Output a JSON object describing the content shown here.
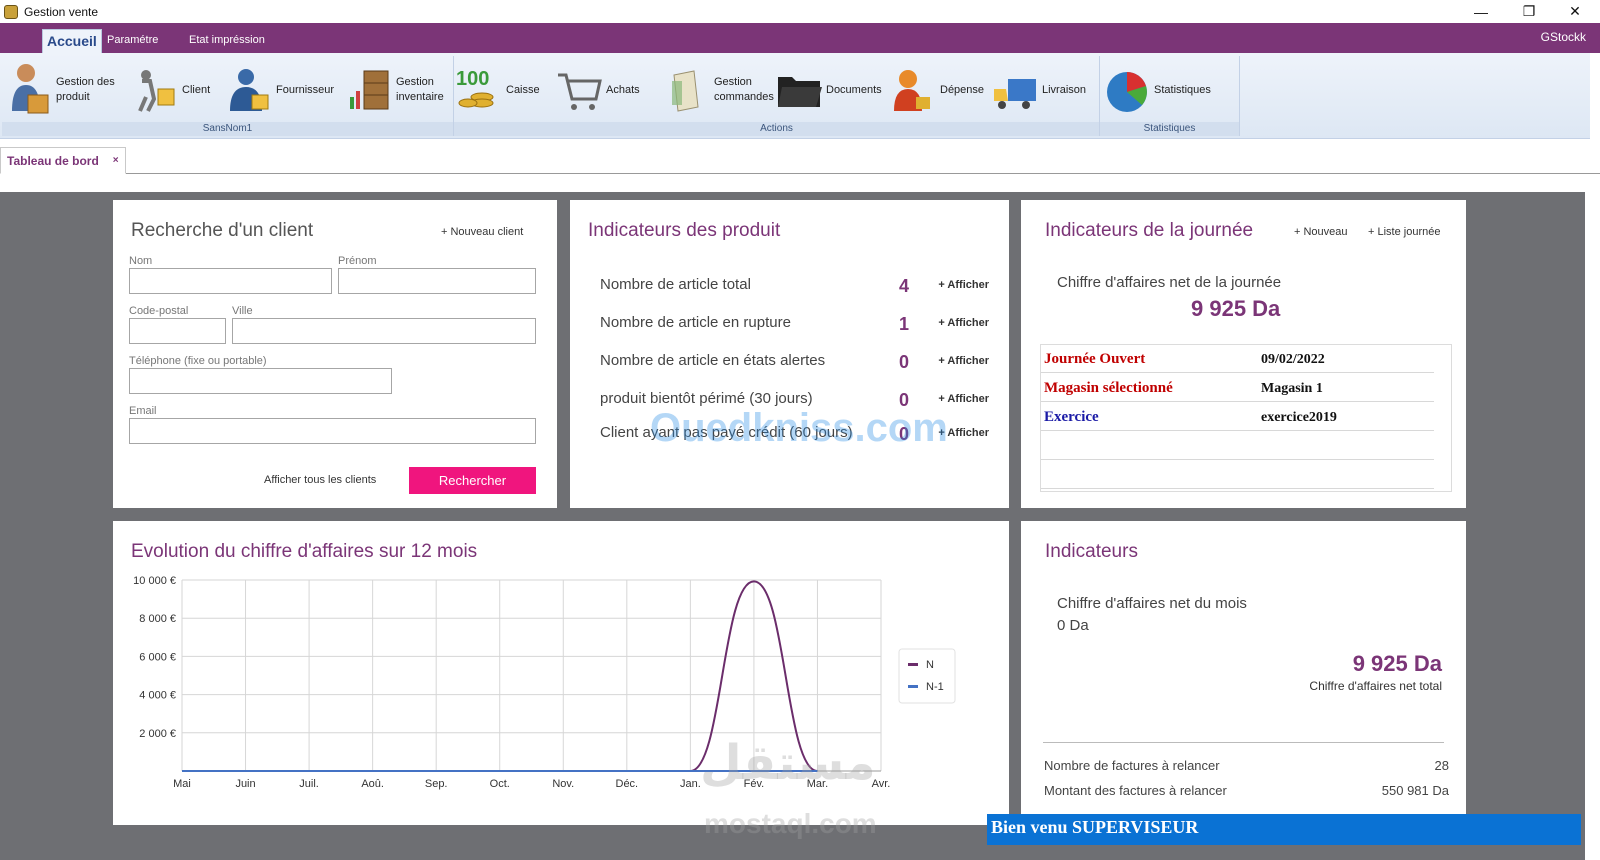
{
  "window": {
    "title": "Gestion vente",
    "minimize": "—",
    "restore": "❐",
    "close": "✕"
  },
  "menu": {
    "tabs": [
      "Accueil",
      "Paramétre",
      "Etat impréssion"
    ],
    "brand": "GStockk"
  },
  "ribbon": {
    "groups": [
      {
        "label": "SansNom1",
        "buttons": [
          {
            "label": "Gestion des produit",
            "icon": "person-box-icon"
          },
          {
            "label": "Client",
            "icon": "delivery-man-icon"
          },
          {
            "label": "Fournisseur",
            "icon": "supplier-icon"
          },
          {
            "label": "Gestion inventaire",
            "icon": "inventory-icon"
          }
        ]
      },
      {
        "label": "Actions",
        "buttons": [
          {
            "label": "Caisse",
            "icon": "coins-icon"
          },
          {
            "label": "Achats",
            "icon": "cart-icon"
          },
          {
            "label": "Gestion commandes",
            "icon": "document-ticket-icon"
          },
          {
            "label": "Documents",
            "icon": "folder-icon"
          },
          {
            "label": "Dépense",
            "icon": "person-money-icon"
          },
          {
            "label": "Livraison",
            "icon": "truck-icon"
          }
        ]
      },
      {
        "label": "Statistiques",
        "buttons": [
          {
            "label": "Statistiques",
            "icon": "pie-chart-icon"
          }
        ]
      }
    ]
  },
  "doc_tab": {
    "label": "Tableau de bord",
    "close": "×"
  },
  "client_search": {
    "title": "Recherche d'un client",
    "new_link": "+ Nouveau client",
    "labels": {
      "nom": "Nom",
      "prenom": "Prénom",
      "cp": "Code-postal",
      "ville": "Ville",
      "tel": "Téléphone (fixe ou portable)",
      "email": "Email"
    },
    "show_all": "Afficher tous les clients",
    "search_button": "Rechercher"
  },
  "product_indicators": {
    "title": "Indicateurs des produit",
    "action_label": "+ Afficher",
    "rows": [
      {
        "label": "Nombre de article total",
        "value": "4"
      },
      {
        "label": "Nombre de article en rupture",
        "value": "1"
      },
      {
        "label": "Nombre de article en états alertes",
        "value": "0"
      },
      {
        "label": "produit bientôt périmé (30 jours)",
        "value": "0"
      },
      {
        "label": "Client ayant pas payé crédit (60 jours)",
        "value": "0"
      }
    ]
  },
  "day_indicators": {
    "title": "Indicateurs de la journée",
    "new_link": "+ Nouveau",
    "list_link": "+ Liste journée",
    "revenue_label": "Chiffre d'affaires net de la journée",
    "revenue_value": "9 925 Da",
    "table": [
      {
        "key": "Journée Ouvert",
        "value": "09/02/2022",
        "color": "#c00000"
      },
      {
        "key": "Magasin sélectionné",
        "value": "Magasin 1",
        "color": "#c00000"
      },
      {
        "key": "Exercice",
        "value": "exercice2019",
        "color": "#1a1aa6"
      }
    ]
  },
  "chart_card": {
    "title": "Evolution du chiffre d'affaires sur 12 mois"
  },
  "chart_data": {
    "type": "line",
    "title": "Evolution du chiffre d'affaires sur 12 mois",
    "categories": [
      "Mai",
      "Juin",
      "Juil.",
      "Aoû.",
      "Sep.",
      "Oct.",
      "Nov.",
      "Déc.",
      "Jan.",
      "Fév.",
      "Mar.",
      "Avr."
    ],
    "yticks": [
      "10 000 €",
      "8 000 €",
      "6 000 €",
      "4 000 €",
      "2 000 €"
    ],
    "ylim": [
      0,
      10000
    ],
    "series": [
      {
        "name": "N",
        "color": "#6b2d6b",
        "values": [
          0,
          0,
          0,
          0,
          0,
          0,
          0,
          0,
          0,
          9925,
          0,
          null
        ]
      },
      {
        "name": "N-1",
        "color": "#4472c4",
        "values": [
          0,
          0,
          0,
          0,
          0,
          0,
          0,
          0,
          0,
          0,
          0,
          null
        ]
      }
    ],
    "legend": "right",
    "grid": true
  },
  "indicators": {
    "title": "Indicateurs",
    "month_label": "Chiffre d'affaires net du mois",
    "month_value": "0 Da",
    "total_value": "9 925 Da",
    "total_label": "Chiffre d'affaires net total",
    "rows": [
      {
        "label": "Nombre de factures à relancer",
        "value": "28"
      },
      {
        "label": "Montant des factures à relancer",
        "value": "550 981 Da"
      }
    ]
  },
  "status_bar": {
    "text": "Bien venu SUPERVISEUR"
  },
  "watermarks": {
    "ouedkniss": "Ouedkniss.com",
    "mostaql_ar": "مستقل",
    "mostaql": "mostaql.com"
  }
}
